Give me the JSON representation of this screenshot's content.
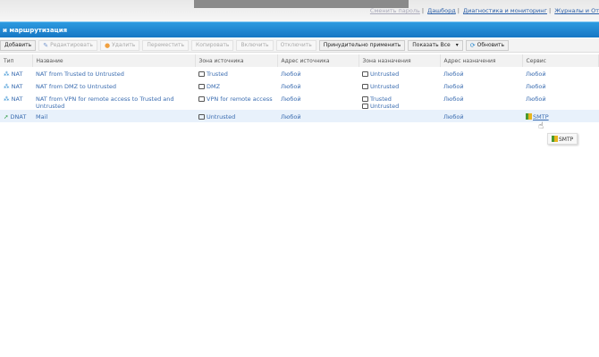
{
  "toplinks": [
    "Сменить пароль",
    "Дашборд",
    "Диагностика и мониторинг",
    "Журналы и От"
  ],
  "header": {
    "title": "и маршрутизация"
  },
  "toolbar": {
    "add": "Добавить",
    "edit": "Редактировать",
    "delete": "Удалить",
    "move": "Переместить",
    "copy": "Копировать",
    "enable": "Включить",
    "disable": "Отключить",
    "force_apply": "Принудительно применить",
    "show_all": "Показать Все",
    "refresh": "Обновить"
  },
  "table": {
    "columns": [
      "Тип",
      "Название",
      "Зона источника",
      "Адрес источника",
      "Зона назначения",
      "Адрес назначения",
      "Сервис"
    ],
    "rows": [
      {
        "type": "NAT",
        "name": "NAT from Trusted to Untrusted",
        "src_zone": "Trusted",
        "src_addr": "Любой",
        "dst_zones": [
          "Untrusted"
        ],
        "dst_addr": "Любой",
        "service": "Любой"
      },
      {
        "type": "NAT",
        "name": "NAT from DMZ to Untrusted",
        "src_zone": "DMZ",
        "src_addr": "Любой",
        "dst_zones": [
          "Untrusted"
        ],
        "dst_addr": "Любой",
        "service": "Любой"
      },
      {
        "type": "NAT",
        "name": "NAT from VPN for remote access to Trusted and Untrusted",
        "src_zone": "VPN for remote access",
        "src_addr": "Любой",
        "dst_zones": [
          "Trusted",
          "Untrusted"
        ],
        "dst_addr": "Любой",
        "service": "Любой"
      },
      {
        "type": "DNAT",
        "name": "Mail",
        "src_zone": "Untrusted",
        "src_addr": "Любой",
        "dst_zones": [],
        "dst_addr": "Любой",
        "service": "SMTP"
      }
    ]
  },
  "tooltip": "SMTP"
}
